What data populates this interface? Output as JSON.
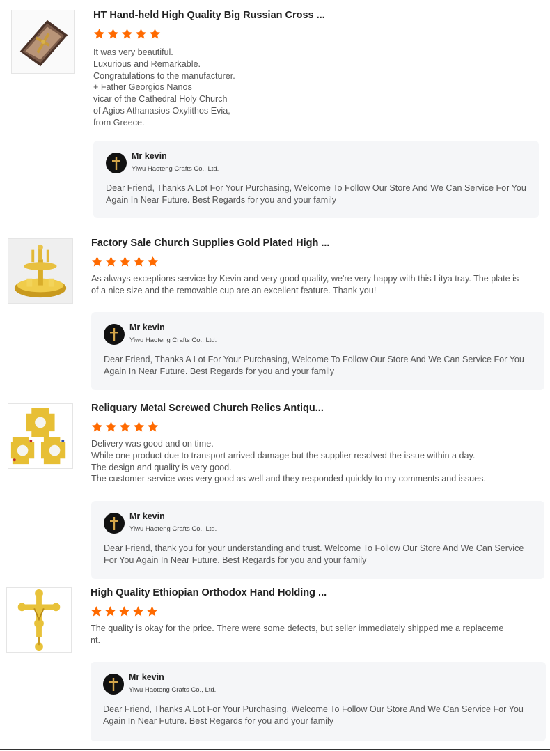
{
  "colors": {
    "star": "#ff6a00",
    "reply_bg": "#f5f6f8"
  },
  "reviews": [
    {
      "title": "HT Hand-held High Quality Big Russian Cross ...",
      "rating": 5,
      "thumb_icon": "cross-in-case-icon",
      "text": "It was very beautiful.\nLuxurious and Remarkable.\nCongratulations to the manufacturer.\n+ Father Georgios Nanos\nvicar of the Cathedral Holy Church\n of Agios Athanasios Oxylithos Evia,\nfrom Greece.",
      "reply": {
        "name": "Mr kevin",
        "company": "Yiwu Haoteng Crafts Co., Ltd.",
        "text": "Dear Friend, Thanks A Lot For Your Purchasing, Welcome To Follow Our Store And We Can Service For You Again In Near Future. Best Regards for you and your family"
      }
    },
    {
      "title": "Factory Sale Church Supplies Gold Plated High ...",
      "rating": 5,
      "thumb_icon": "gold-tray-icon",
      "text": "As always exceptions service by Kevin and very good quality, we're very happy with this Litya tray. The plate is of a nice size and the removable cup are an excellent feature. Thank you!",
      "reply": {
        "name": "Mr kevin",
        "company": "Yiwu Haoteng Crafts Co., Ltd.",
        "text": "Dear Friend, Thanks A Lot For Your Purchasing, Welcome To Follow Our Store And We Can Service For You Again In Near Future. Best Regards for you and your family"
      }
    },
    {
      "title": "Reliquary Metal Screwed Church Relics Antiqu...",
      "rating": 5,
      "thumb_icon": "reliquary-icon",
      "text": "Delivery was good and on time.\nWhile one product due to transport arrived damage but the supplier resolved the issue within a day.\nThe design and quality is very good.\nThe customer service was very good as well and they responded quickly to my comments and issues.",
      "reply": {
        "name": "Mr kevin",
        "company": "Yiwu Haoteng Crafts Co., Ltd.",
        "text": "Dear Friend, thank you for your understanding and trust. Welcome To Follow Our Store And We Can Service For You Again In Near Future. Best Regards for you and your family"
      }
    },
    {
      "title": "High Quality Ethiopian Orthodox Hand Holding ...",
      "rating": 5,
      "thumb_icon": "gold-cross-icon",
      "text": "The quality is okay for the price. There were some defects, but seller immediately shipped me a replaceme\nnt.",
      "reply": {
        "name": "Mr kevin",
        "company": "Yiwu Haoteng Crafts Co., Ltd.",
        "text": "Dear Friend, Thanks A Lot For Your Purchasing, Welcome To Follow Our Store And We Can Service For You Again In Near Future. Best Regards for you and your family"
      }
    }
  ]
}
